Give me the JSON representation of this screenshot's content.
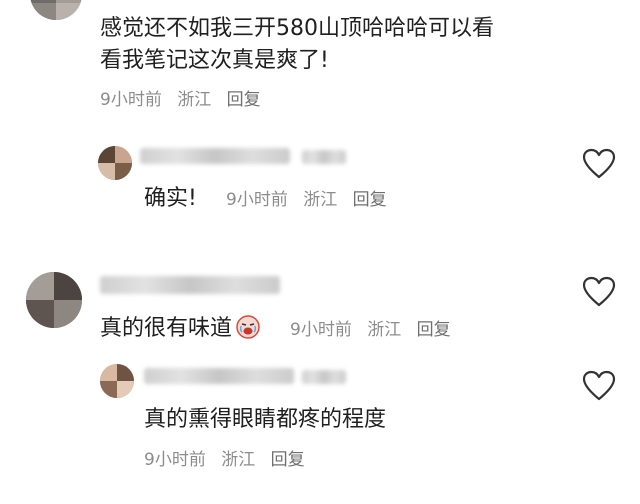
{
  "comments": [
    {
      "text_line1": "感觉还不如我三开580山顶哈哈哈可以看",
      "text_line2": "看我笔记这次真是爽了!",
      "meta": {
        "time": "9小时前",
        "location": "浙江",
        "reply": "回复"
      },
      "replies": [
        {
          "text": "确实!",
          "meta": {
            "time": "9小时前",
            "location": "浙江",
            "reply": "回复"
          },
          "like_icon": "heart-outline-icon"
        }
      ]
    },
    {
      "text": "真的很有味道",
      "emoji": "crying-face-emoji",
      "meta": {
        "time": "9小时前",
        "location": "浙江",
        "reply": "回复"
      },
      "like_icon": "heart-outline-icon",
      "replies": [
        {
          "text": "真的熏得眼睛都疼的程度",
          "meta": {
            "time": "9小时前",
            "location": "浙江",
            "reply": "回复"
          },
          "like_icon": "heart-outline-icon"
        }
      ]
    }
  ],
  "colors": {
    "text": "#1f1f1f",
    "meta": "#8c8c8c",
    "icon_stroke": "#333333"
  }
}
